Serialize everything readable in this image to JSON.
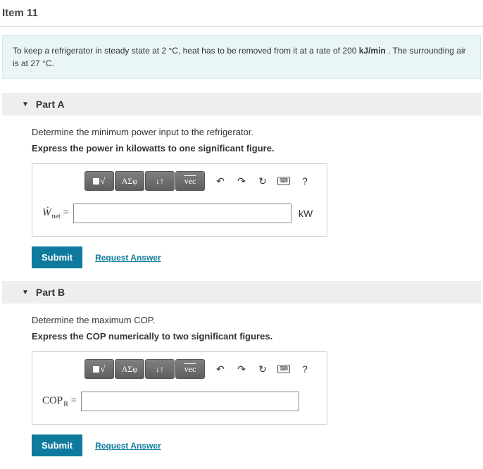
{
  "header": {
    "title": "Item 11"
  },
  "problem": {
    "text_before_t1": "To keep a refrigerator in steady state at 2 ",
    "unit_deg": "°C",
    "text_mid1": ", heat has to be removed from it at a rate of 200 ",
    "unit_rate": "kJ/min",
    "text_mid2": " . The surrounding air is at 27 ",
    "unit_deg2": "°C",
    "text_end": "."
  },
  "toolbar": {
    "greek": "ΑΣφ",
    "arrows": "↓↑",
    "vec": "vec",
    "help": "?"
  },
  "parts": {
    "a": {
      "label": "Part A",
      "question": "Determine the minimum power input to the refrigerator.",
      "instruction": "Express the power in kilowatts to one significant figure.",
      "lhs_main": "Ẇ",
      "lhs_sub": "net",
      "equals": " =",
      "unit": "kW",
      "submit": "Submit",
      "request": "Request Answer"
    },
    "b": {
      "label": "Part B",
      "question": "Determine the maximum COP.",
      "instruction": "Express the COP numerically to two significant figures.",
      "lhs_html": "COP",
      "lhs_sub": "R",
      "equals": " =",
      "submit": "Submit",
      "request": "Request Answer"
    }
  }
}
